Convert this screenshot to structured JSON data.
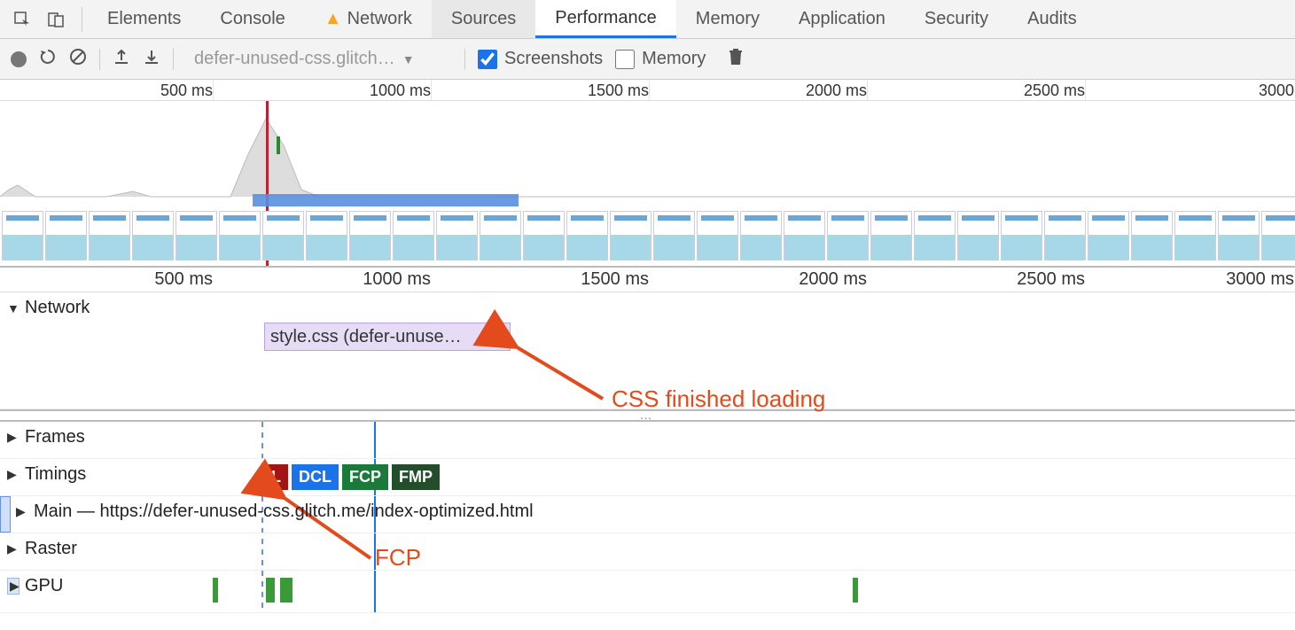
{
  "tabs": {
    "elements": "Elements",
    "console": "Console",
    "network": "Network",
    "sources": "Sources",
    "performance": "Performance",
    "memory": "Memory",
    "application": "Application",
    "security": "Security",
    "audits": "Audits"
  },
  "toolbar": {
    "dropdown_label": "defer-unused-css.glitch…",
    "screenshots_label": "Screenshots",
    "memory_label": "Memory"
  },
  "overview_ruler": {
    "t500": "500 ms",
    "t1000": "1000 ms",
    "t1500": "1500 ms",
    "t2000": "2000 ms",
    "t2500": "2500 ms",
    "t3000": "3000"
  },
  "details_ruler": {
    "t500": "500 ms",
    "t1000": "1000 ms",
    "t1500": "1500 ms",
    "t2000": "2000 ms",
    "t2500": "2500 ms",
    "t3000": "3000 ms"
  },
  "tracks": {
    "network_label": "Network",
    "network_item": "style.css (defer-unuse…",
    "frames_label": "Frames",
    "timings_label": "Timings",
    "main_label": "Main — https://defer-unused-css.glitch.me/index-optimized.html",
    "raster_label": "Raster",
    "gpu_label": "GPU"
  },
  "timings": {
    "L": "L",
    "DCL": "DCL",
    "FCP": "FCP",
    "FMP": "FMP"
  },
  "annotations": {
    "css_loaded": "CSS finished loading",
    "fcp": "FCP"
  }
}
